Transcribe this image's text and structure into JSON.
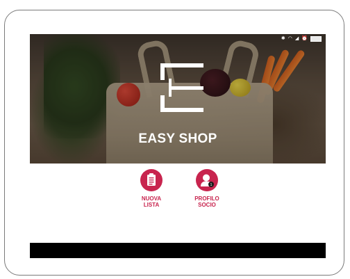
{
  "app": {
    "title": "EASY SHOP"
  },
  "actions": [
    {
      "icon": "shopping-list-icon",
      "label": "NUOVA\nLISTA"
    },
    {
      "icon": "member-profile-icon",
      "label": "PROFILO\nSOCIO"
    }
  ],
  "colors": {
    "accent": "#c8244e",
    "nav_bar": "#000000",
    "title_text": "#ffffff"
  },
  "status_bar": {
    "icons": [
      "bluetooth-icon",
      "wifi-icon",
      "signal-icon",
      "alarm-icon",
      "battery-icon"
    ]
  }
}
